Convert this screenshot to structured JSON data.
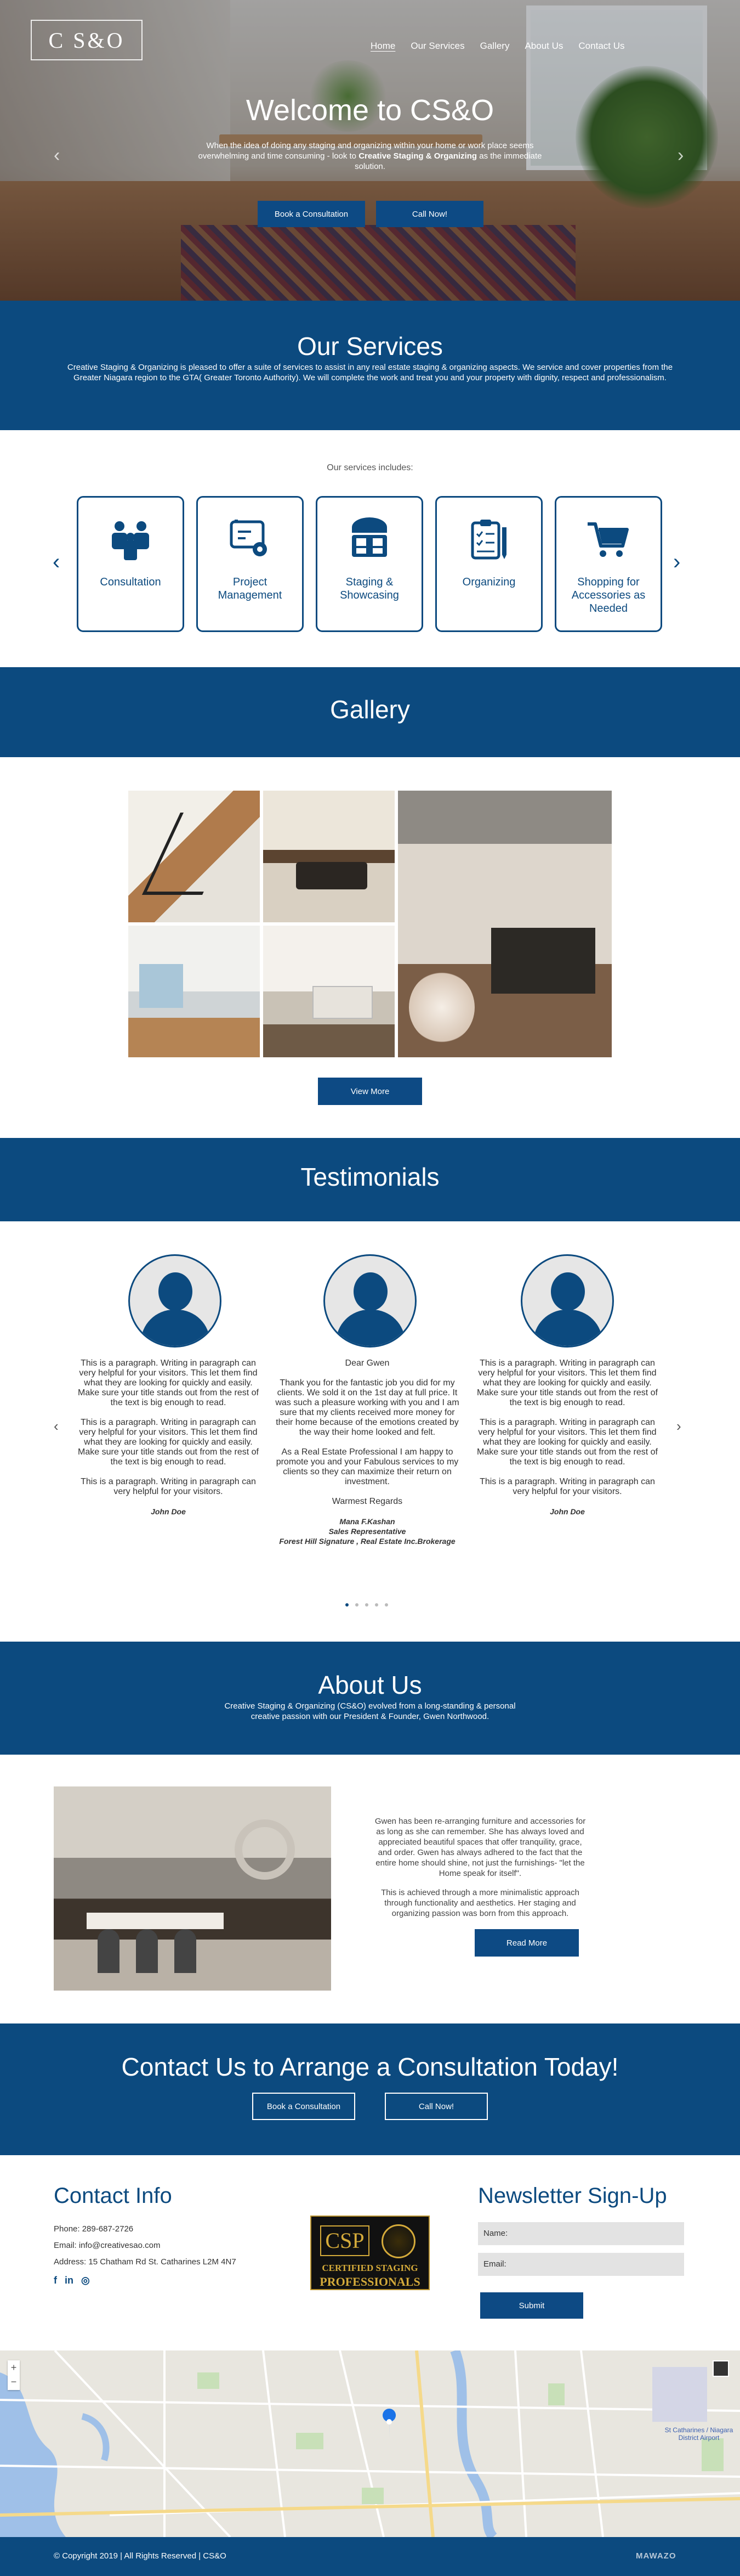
{
  "brand": {
    "logo_text": "C S&O",
    "primary_color": "#0c4a7f"
  },
  "nav": {
    "items": [
      "Home",
      "Our Services",
      "Gallery",
      "About Us",
      "Contact Us"
    ],
    "active": "Home"
  },
  "hero": {
    "title": "Welcome to CS&O",
    "subtitle_part1": "When the idea of doing any staging and organizing within your home or work place seems overwhelming and time consuming - look to ",
    "subtitle_bold": "Creative Staging & Organizing",
    "subtitle_part2": " as the immediate solution.",
    "btn_consult": "Book a Consultation",
    "btn_call": "Call Now!",
    "arrow_left": "‹",
    "arrow_right": "›"
  },
  "services": {
    "heading": "Our Services",
    "text": "Creative Staging & Organizing is pleased to offer a suite of services to assist in any real estate staging & organizing aspects. We service and cover properties from the Greater Niagara region to the GTA( Greater Toronto Authority). We will complete the work and treat you and your property with dignity, respect and professionalism.",
    "includes_label": "Our services includes:",
    "cards": [
      {
        "label": "Consultation",
        "icon": "consultation-icon"
      },
      {
        "label": "Project Management",
        "icon": "project-management-icon"
      },
      {
        "label": "Staging & Showcasing",
        "icon": "staging-icon"
      },
      {
        "label": "Organizing",
        "icon": "clipboard-icon"
      },
      {
        "label": "Shopping for Accessories as Needed",
        "icon": "cart-icon"
      }
    ],
    "prev": "‹",
    "next": "›"
  },
  "gallery": {
    "heading": "Gallery",
    "view_more": "View More"
  },
  "testimonials": {
    "heading": "Testimonials",
    "prev": "‹",
    "next": "›",
    "items": [
      {
        "paragraphs": [
          "This is a paragraph. Writing in paragraph can very helpful for your visitors. This let them find what they are looking for quickly and easily. Make sure your title stands out from the rest of the text is big enough to read.",
          "This is a paragraph. Writing in paragraph can very helpful for your visitors. This let them find what they are looking for quickly and easily. Make sure your title stands out from the rest of the text is big enough to read.",
          "This is a paragraph. Writing in paragraph can very helpful for your visitors."
        ],
        "sig_lines": [
          "John Doe"
        ]
      },
      {
        "paragraphs": [
          "Dear Gwen",
          "Thank you for the fantastic job you did for my clients. We sold it on the 1st day at full price. It was such a pleasure working with you and I am sure that my clients received more money for their home because of the emotions created by the way their home looked and felt.",
          "As a Real Estate Professional I am happy to promote you and your Fabulous  services to my clients so they can maximize their return on investment.",
          "Warmest Regards"
        ],
        "sig_lines": [
          "Mana  F.Kashan",
          "Sales Representative",
          "Forest Hill Signature , Real Estate Inc.Brokerage"
        ]
      },
      {
        "paragraphs": [
          "This is a paragraph. Writing in paragraph can very helpful for your visitors. This let them find what they are looking for quickly and easily. Make sure your title stands out from the rest of the text is big enough to read.",
          "This is a paragraph. Writing in paragraph can very helpful for your visitors. This let them find what they are looking for quickly and easily. Make sure your title stands out from the rest of the text is big enough to read.",
          "This is a paragraph. Writing in paragraph can very helpful for your visitors."
        ],
        "sig_lines": [
          "John Doe"
        ]
      }
    ]
  },
  "about": {
    "heading": "About Us",
    "subtitle": "Creative Staging & Organizing (CS&O) evolved from a long-standing & personal creative passion with our President & Founder, Gwen Northwood.",
    "para1": "Gwen has been re-arranging furniture and accessories for as long as she can remember. She has always loved and appreciated beautiful spaces that offer tranquility, grace, and order. Gwen has always adhered to the fact that the entire home should shine, not just the furnishings- \"let the Home speak for itself\".",
    "para2": "This is achieved through a more minimalistic approach through functionality and aesthetics. Her staging and organizing passion was born from this approach.",
    "read_more": "Read More"
  },
  "cta": {
    "heading": "Contact Us to Arrange a Consultation Today!",
    "btn_consult": "Book a Consultation",
    "btn_call": "Call Now!"
  },
  "contact": {
    "heading": "Contact Info",
    "phone": "Phone: 289-687-2726",
    "email": "Email: info@creativesao.com",
    "address": "Address: 15 Chatham Rd St. Catharines L2M 4N7",
    "social": [
      "f",
      "in",
      "◎"
    ]
  },
  "badge": {
    "line1": "CERTIFIED STAGING",
    "line2": "PROFESSIONALS",
    "mark": "CSP"
  },
  "newsletter": {
    "heading": "Newsletter Sign-Up",
    "name_label": "Name:",
    "email_label": "Email:",
    "submit": "Submit"
  },
  "map": {
    "airport_label": "St Catharines / Niagara District Airport",
    "zoom_plus": "+",
    "zoom_minus": "−"
  },
  "footer": {
    "copyright": "© Copyright 2019 | All Rights Reserved | CS&O",
    "credit": "MAWAZO"
  }
}
